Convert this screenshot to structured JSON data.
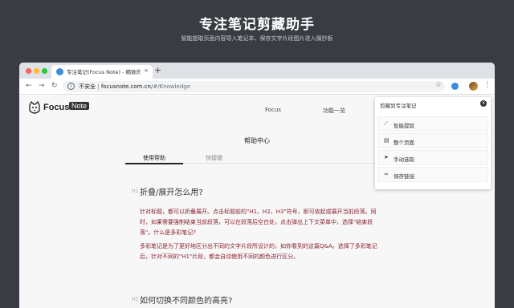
{
  "hero": {
    "title": "专注笔记剪藏助手",
    "subtitle": "智能提取页面内容导入笔记本、保存文字片段图片进入摘抄板"
  },
  "browser": {
    "tab_title": "专注笔记(Focus Note) - 精致的笔记",
    "tab_close": "×",
    "new_tab": "+",
    "security_label": "不安全",
    "url_host": "focusnote.com.cn",
    "url_path": "/#/Knowledge"
  },
  "site": {
    "logo_text": "Focus",
    "logo_badge": "Note",
    "nav": [
      "Focus",
      "功能一览"
    ]
  },
  "help": {
    "title": "帮助中心",
    "tabs": [
      "使用帮助",
      "快捷键"
    ],
    "h_marker": "H1",
    "q1": "折叠/展开怎么用?",
    "p1": "针对标题，都可以折叠展开。点击标题前的\"H1、H2、H3\"符号，即可收起或展开当前段落。同时，如果需要强制结束当前段落，可以在段落后空白处，点击弹出上下文菜单中，选择\"结束段落\"。什么是多彩笔记?",
    "p2": "多彩笔记是为了更好地区分出不同的文字片段所设计的，如你看到的这篇Q&A。选择了多彩笔记后，针对不同的\"H1\"片段，都会自动使用不同的颜色进行区分。",
    "q2": "如何切换不同颜色的高亮?"
  },
  "popup": {
    "title": "剪藏到专注笔记",
    "items": [
      {
        "label": "智能提取",
        "icon": "magic-wand-icon"
      },
      {
        "label": "整个页面",
        "icon": "document-icon"
      },
      {
        "label": "手动选取",
        "icon": "cursor-icon"
      },
      {
        "label": "保存链接",
        "icon": "link-icon"
      }
    ]
  },
  "colors": {
    "background": "#393c43",
    "accent_text": "#8b2232"
  }
}
